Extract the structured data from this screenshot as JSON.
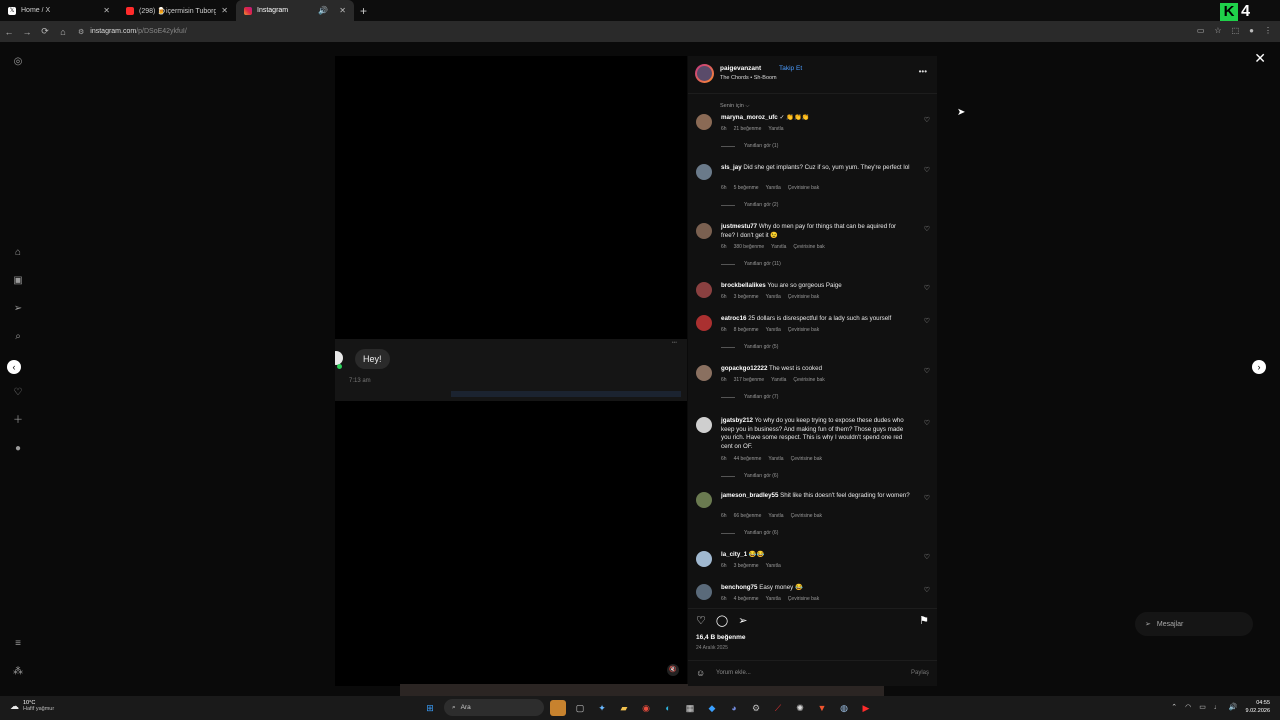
{
  "browser": {
    "tabs": [
      {
        "title": "Home / X",
        "favicon": "x-icon",
        "color": "#ffffff"
      },
      {
        "title": "(298) 🍺içermisin Tuborg🍺#...",
        "favicon": "youtube-icon",
        "color": "#ff2b2b"
      },
      {
        "title": "Instagram",
        "favicon": "instagram-icon",
        "color": "#e1306c",
        "active": true
      }
    ],
    "new_tab": "+",
    "url_host": "instagram.com",
    "url_path": "/p/DSoE42ykfuI/",
    "brand_letter": "K",
    "brand_number": "4"
  },
  "post": {
    "username": "paigevanzant",
    "follow_label": "Takip Et",
    "song": "The Chords • Sh-Boom",
    "sort_label": "Senin için ⌵"
  },
  "media": {
    "bubble_text": "Hey!",
    "bubble_time": "7:13 am"
  },
  "comments": [
    {
      "user": "maryna_moroz_ufc",
      "text": "✓ 👏👏👏",
      "time": "6h",
      "likes": "21 beğenme",
      "reply": "Yanıtla",
      "translate": "",
      "replies": "Yanıtları gör (1)"
    },
    {
      "user": "sls_jay",
      "text": "Did she get implants? Cuz if so, yum yum. They're perfect lol",
      "time": "6h",
      "likes": "5 beğenme",
      "reply": "Yanıtla",
      "translate": "Çevirisine bak",
      "replies": "Yanıtları gör (2)"
    },
    {
      "user": "justmestu77",
      "text": "Why do men pay for things that can be aquired for free? I don't get it 😉",
      "time": "6h",
      "likes": "380 beğenme",
      "reply": "Yanıtla",
      "translate": "Çevirisine bak",
      "replies": "Yanıtları gör (11)"
    },
    {
      "user": "brockbellalikes",
      "text": "You are so gorgeous Paige",
      "time": "6h",
      "likes": "3 beğenme",
      "reply": "Yanıtla",
      "translate": "Çevirisine bak",
      "replies": ""
    },
    {
      "user": "eatroc16",
      "text": "25 dollars is disrespectful for a lady such as yourself",
      "time": "6h",
      "likes": "8 beğenme",
      "reply": "Yanıtla",
      "translate": "Çevirisine bak",
      "replies": "Yanıtları gör (5)"
    },
    {
      "user": "gopackgo12222",
      "text": "The west is cooked",
      "time": "6h",
      "likes": "317 beğenme",
      "reply": "Yanıtla",
      "translate": "Çevirisine bak",
      "replies": "Yanıtları gör (7)"
    },
    {
      "user": "jgatsby212",
      "text": "Yo why do you keep trying to expose these dudes who keep you in business? And making fun of them? Those guys made you rich. Have some respect. This is why I wouldn't spend one red cent on OF.",
      "time": "6h",
      "likes": "44 beğenme",
      "reply": "Yanıtla",
      "translate": "Çevirisine bak",
      "replies": "Yanıtları gör (6)"
    },
    {
      "user": "jameson_bradley55",
      "text": "Shit like this doesn't feel degrading for women?",
      "time": "6h",
      "likes": "66 beğenme",
      "reply": "Yanıtla",
      "translate": "Çevirisine bak",
      "replies": "Yanıtları gör (6)"
    },
    {
      "user": "la_city_1",
      "text": "😂😂",
      "time": "6h",
      "likes": "3 beğenme",
      "reply": "Yanıtla",
      "translate": "",
      "replies": ""
    },
    {
      "user": "benchong75",
      "text": "Easy money 😂",
      "time": "6h",
      "likes": "4 beğenme",
      "reply": "Yanıtla",
      "translate": "Çevirisine bak",
      "replies": ""
    }
  ],
  "footer": {
    "likes": "16,4 B beğenme",
    "date": "24 Aralık 2025",
    "comment_placeholder": "Yorum ekle...",
    "share_label": "Paylaş"
  },
  "messages_pill": "Mesajlar",
  "taskbar": {
    "temp": "10°C",
    "weather": "Hafif yağmur",
    "search": "Ara",
    "time": "04:55",
    "date": "9.02.2026"
  }
}
